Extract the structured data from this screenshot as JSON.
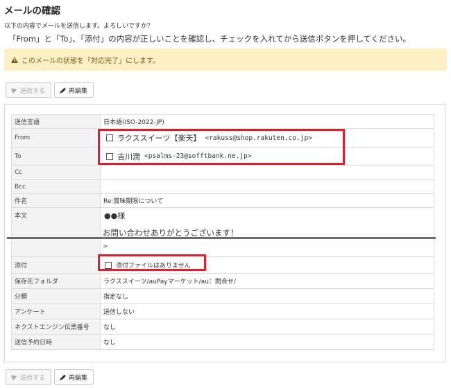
{
  "title": "メールの確認",
  "intro1": "以下の内容でメールを送信します。よろしいですか？",
  "intro2": "「From」と「To」、「添付」の内容が正しいことを確認し、チェックを入れてから送信ボタンを押してください。",
  "warning": "このメールの状態を「対応完了」にします。",
  "buttons": {
    "send": "送信する",
    "edit": "再編集"
  },
  "fields": {
    "charset_label": "送信言語",
    "charset_value": "日本語(ISO-2022-JP)",
    "from_label": "From",
    "from_name": "ラクススイーツ【楽天】",
    "from_addr": "<rakuss@shop.rakuten.co.jp>",
    "to_label": "To",
    "to_name": "吉川潤",
    "to_addr": "<psalms-23@sofftbank.ne.jp>",
    "cc_label": "Cc",
    "bcc_label": "Bcc",
    "subject_label": "件名",
    "subject_value": "Re:賞味期限について",
    "body_label": "本文",
    "body_line1": "●●様",
    "body_line2": "お問い合わせありがとうございます！",
    "body_line3": ">",
    "attach_label": "添付",
    "attach_value": "添付ファイルはありません",
    "folder_label": "保存先フォルダ",
    "folder_value": "ラクススイーツ/auPayマーケット/au：問合せ/",
    "category_label": "分類",
    "category_value": "指定なし",
    "survey_label": "アンケート",
    "survey_value": "送信しない",
    "ne_label": "ネクストエンジン伝票番号",
    "ne_value": "なし",
    "schedule_label": "送信予約日時",
    "schedule_value": "なし"
  }
}
